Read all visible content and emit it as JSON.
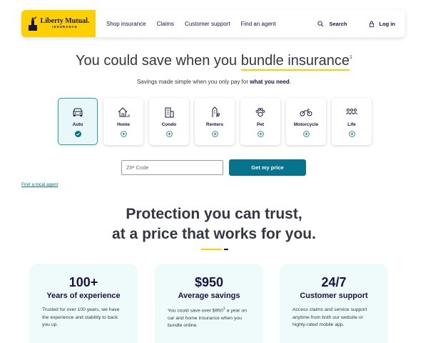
{
  "brand": {
    "name": "Liberty Mutual.",
    "sub": "INSURANCE"
  },
  "nav": {
    "items": [
      "Shop insurance",
      "Claims",
      "Customer support",
      "Find an agent"
    ],
    "search_label": "Search",
    "login_label": "Log in"
  },
  "hero": {
    "title_prefix": "You could save when you ",
    "title_highlight": "bundle insurance",
    "title_sup": "1",
    "subtitle_prefix": "Savings made simple when you only pay for ",
    "subtitle_bold": "what you need",
    "subtitle_suffix": "."
  },
  "products": [
    {
      "label": "Auto",
      "icon": "car-icon",
      "selected": true
    },
    {
      "label": "Home",
      "icon": "house-icon",
      "selected": false
    },
    {
      "label": "Condo",
      "icon": "building-icon",
      "selected": false
    },
    {
      "label": "Renters",
      "icon": "apartment-icon",
      "selected": false
    },
    {
      "label": "Pet",
      "icon": "paw-icon",
      "selected": false
    },
    {
      "label": "Motorcycle",
      "icon": "motorcycle-icon",
      "selected": false
    },
    {
      "label": "Life",
      "icon": "people-icon",
      "selected": false
    }
  ],
  "quote": {
    "zip_placeholder": "ZIP Code",
    "zip_value": "",
    "button_label": "Get my price",
    "find_agent_label": "Find a local agent"
  },
  "protection": {
    "line1": "Protection you can trust,",
    "line2": "at a price that works for you."
  },
  "stats": [
    {
      "number": "100+",
      "label": "Years of experience",
      "description": "Trusted for over 100 years, we have the experience and stability to back you up."
    },
    {
      "number": "$950",
      "label": "Average savings",
      "description_prefix": "You could save over $950",
      "description_sup": "1",
      "description_suffix": " a year on car and home insurance when you bundle online."
    },
    {
      "number": "24/7",
      "label": "Customer support",
      "description": "Access claims and service support anytime from both our website or highly-rated mobile app."
    }
  ],
  "colors": {
    "brand_yellow": "#ffd000",
    "navy": "#1a1446",
    "teal": "#06748c",
    "card_bg": "#effafb"
  }
}
